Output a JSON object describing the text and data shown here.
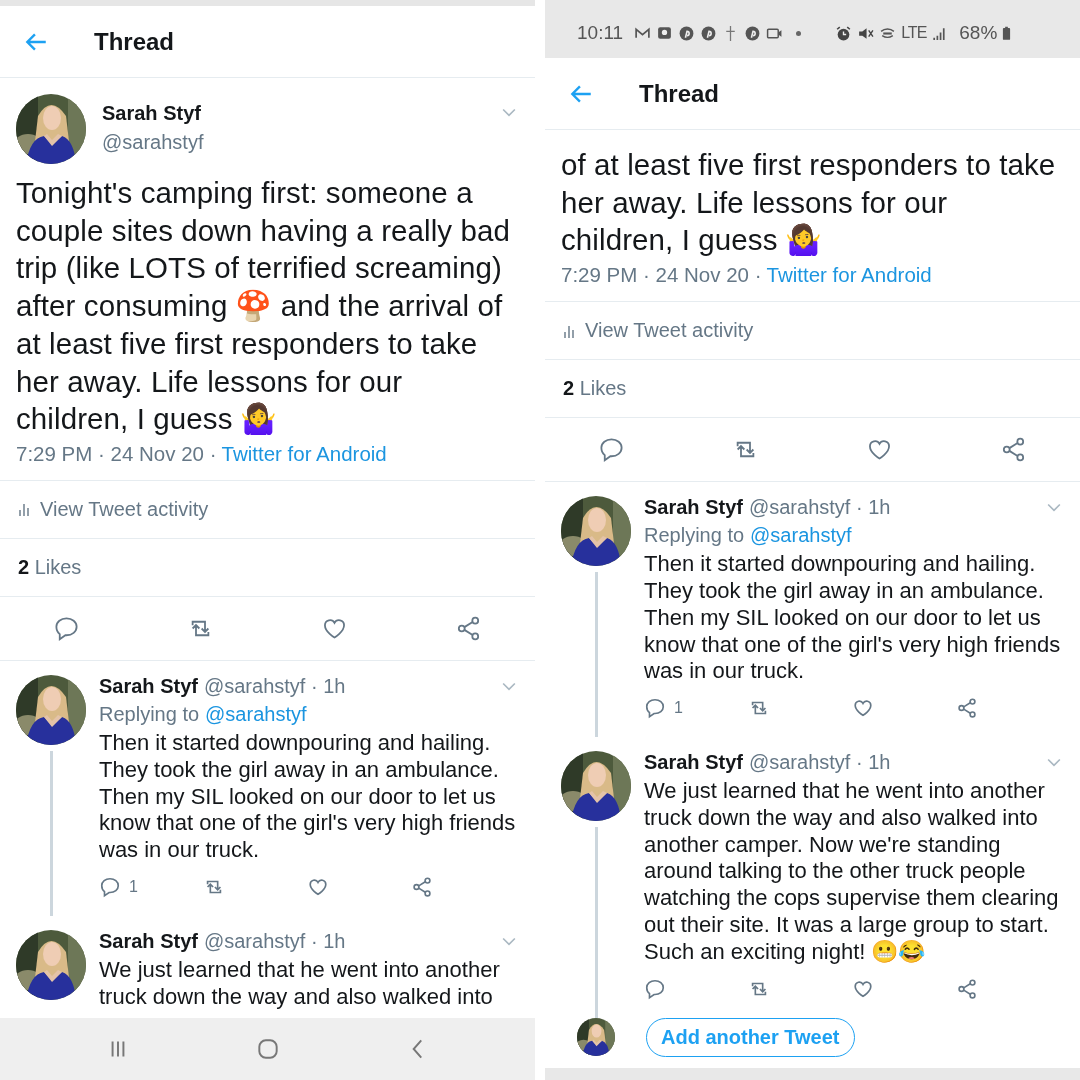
{
  "panels": [
    {
      "navigation_bar": true,
      "header": {
        "title": "Thread"
      },
      "main_tweet": {
        "name": "Sarah Styf",
        "handle": "@sarahstyf",
        "body": "Tonight's camping first: someone a couple sites down having a really bad trip (like LOTS of terrified screaming) after consuming 🍄 and the arrival of at least five first responders to take her away. Life lessons for our children, I guess 🤷‍♀️",
        "time": "7:29 PM · 24 Nov 20 ·",
        "source": "Twitter for Android"
      },
      "activity": "View Tweet activity",
      "likes": {
        "count": "2",
        "label": "Likes"
      },
      "replies": [
        {
          "name": "Sarah Styf",
          "handle": "@sarahstyf · 1h",
          "replying_label": "Replying to",
          "replying_to": "@sarahstyf",
          "body": "Then it started downpouring and hailing. They took the girl away in an ambulance. Then my SIL looked on our door to let us know that one of the girl's very high friends was in our truck.",
          "reply_count": "1",
          "actions": true
        },
        {
          "name": "Sarah Styf",
          "handle": "@sarahstyf · 1h",
          "body": "We just learned that he went into another truck down the way and also walked into",
          "actions": false
        }
      ]
    },
    {
      "status_bar": {
        "time": "10:11",
        "network": "LTE",
        "battery": "68%"
      },
      "header": {
        "title": "Thread"
      },
      "main_tweet": {
        "body": "of at least five first responders to take her away. Life lessons for our children, I guess 🤷‍♀️",
        "time": "7:29 PM · 24 Nov 20 ·",
        "source": "Twitter for Android"
      },
      "activity": "View Tweet activity",
      "likes": {
        "count": "2",
        "label": "Likes"
      },
      "replies": [
        {
          "name": "Sarah Styf",
          "handle": "@sarahstyf · 1h",
          "replying_label": "Replying to",
          "replying_to": "@sarahstyf",
          "body": "Then it started downpouring and hailing. They took the girl away in an ambulance. Then my SIL looked on our door to let us know that one of the girl's very high friends was in our truck.",
          "reply_count": "1",
          "actions": true
        },
        {
          "name": "Sarah Styf",
          "handle": "@sarahstyf · 1h",
          "body": "We just learned that he went into another truck down the way and also walked into another camper. Now we're standing around talking to the other truck people watching the cops supervise them clearing out their site. It was a large group to start.  Such an exciting night! 😬😂",
          "actions": true
        }
      ],
      "compose": {
        "button": "Add another Tweet"
      }
    }
  ]
}
